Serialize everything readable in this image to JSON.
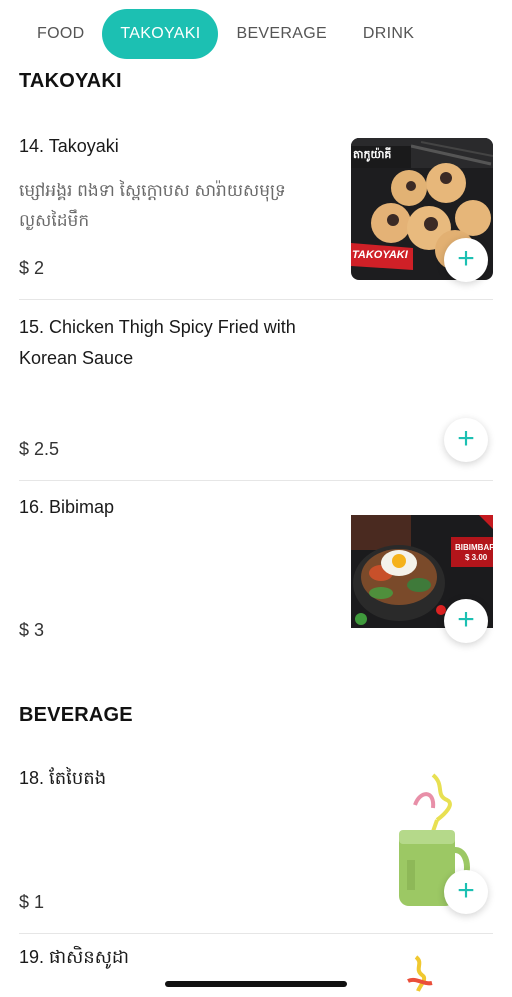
{
  "tabs": [
    {
      "label": "FOOD"
    },
    {
      "label": "TAKOYAKI",
      "active": true
    },
    {
      "label": "BEVERAGE"
    },
    {
      "label": "DRINK"
    }
  ],
  "accent_color": "#1cc0b2",
  "sections": {
    "takoyaki": {
      "title": "TAKOYAKI",
      "items": [
        {
          "name": "14. Takoyaki",
          "description": "ម្សៅអង្គរ ពងទា ស្ពៃក្ដោបស សារ៉ាយសមុទ្រ ល្ងសដៃមឹក",
          "price": "$ 2",
          "image_banner": "TAKOYAKI",
          "image_top_text": "តាកូយ៉ាគី",
          "add_icon": "plus-icon"
        },
        {
          "name": "15. Chicken Thigh Spicy Fried with Korean Sauce",
          "price": "$ 2.5",
          "add_icon": "plus-icon"
        },
        {
          "name": "16. Bibimap",
          "price": "$ 3",
          "image_banner": "BIBIMBAP",
          "image_banner_price": "$ 3.00",
          "add_icon": "plus-icon"
        }
      ]
    },
    "beverage": {
      "title": "BEVERAGE",
      "items": [
        {
          "name": "18. តែបៃតង",
          "price": "$ 1",
          "add_icon": "plus-icon"
        },
        {
          "name": "19. ផាសិនសូដា"
        }
      ]
    }
  }
}
